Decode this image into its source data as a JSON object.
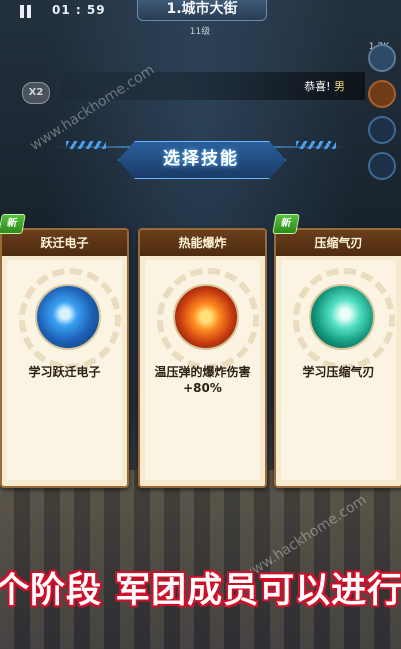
{
  "hud": {
    "timer": "01 : 59",
    "stage_title": "1.城市大街",
    "stage_sub": "11级",
    "speed": "X2",
    "counter": "1.7K",
    "banner_text": "恭喜! ",
    "banner_highlight": "男"
  },
  "header": {
    "title": "选择技能"
  },
  "cards": [
    {
      "name": "跃迁电子",
      "icon": "electron-burst-icon",
      "description": "学习跃迁电子",
      "is_new": true,
      "new_label": "新"
    },
    {
      "name": "热能爆炸",
      "icon": "thermal-shell-icon",
      "description": "温压弹的爆炸伤害\n+80%",
      "is_new": false
    },
    {
      "name": "压缩气刃",
      "icon": "compressed-blade-icon",
      "description": "学习压缩气刃",
      "is_new": true,
      "new_label": "新"
    }
  ],
  "caption": "个阶段 军团成员可以进行",
  "watermark": "www.hackhome.com",
  "colors": {
    "caption_outline": "#d0102a",
    "header_blue": "#2a5f9c",
    "card_head": "#6a3f1b",
    "new_green": "#55c13a"
  }
}
